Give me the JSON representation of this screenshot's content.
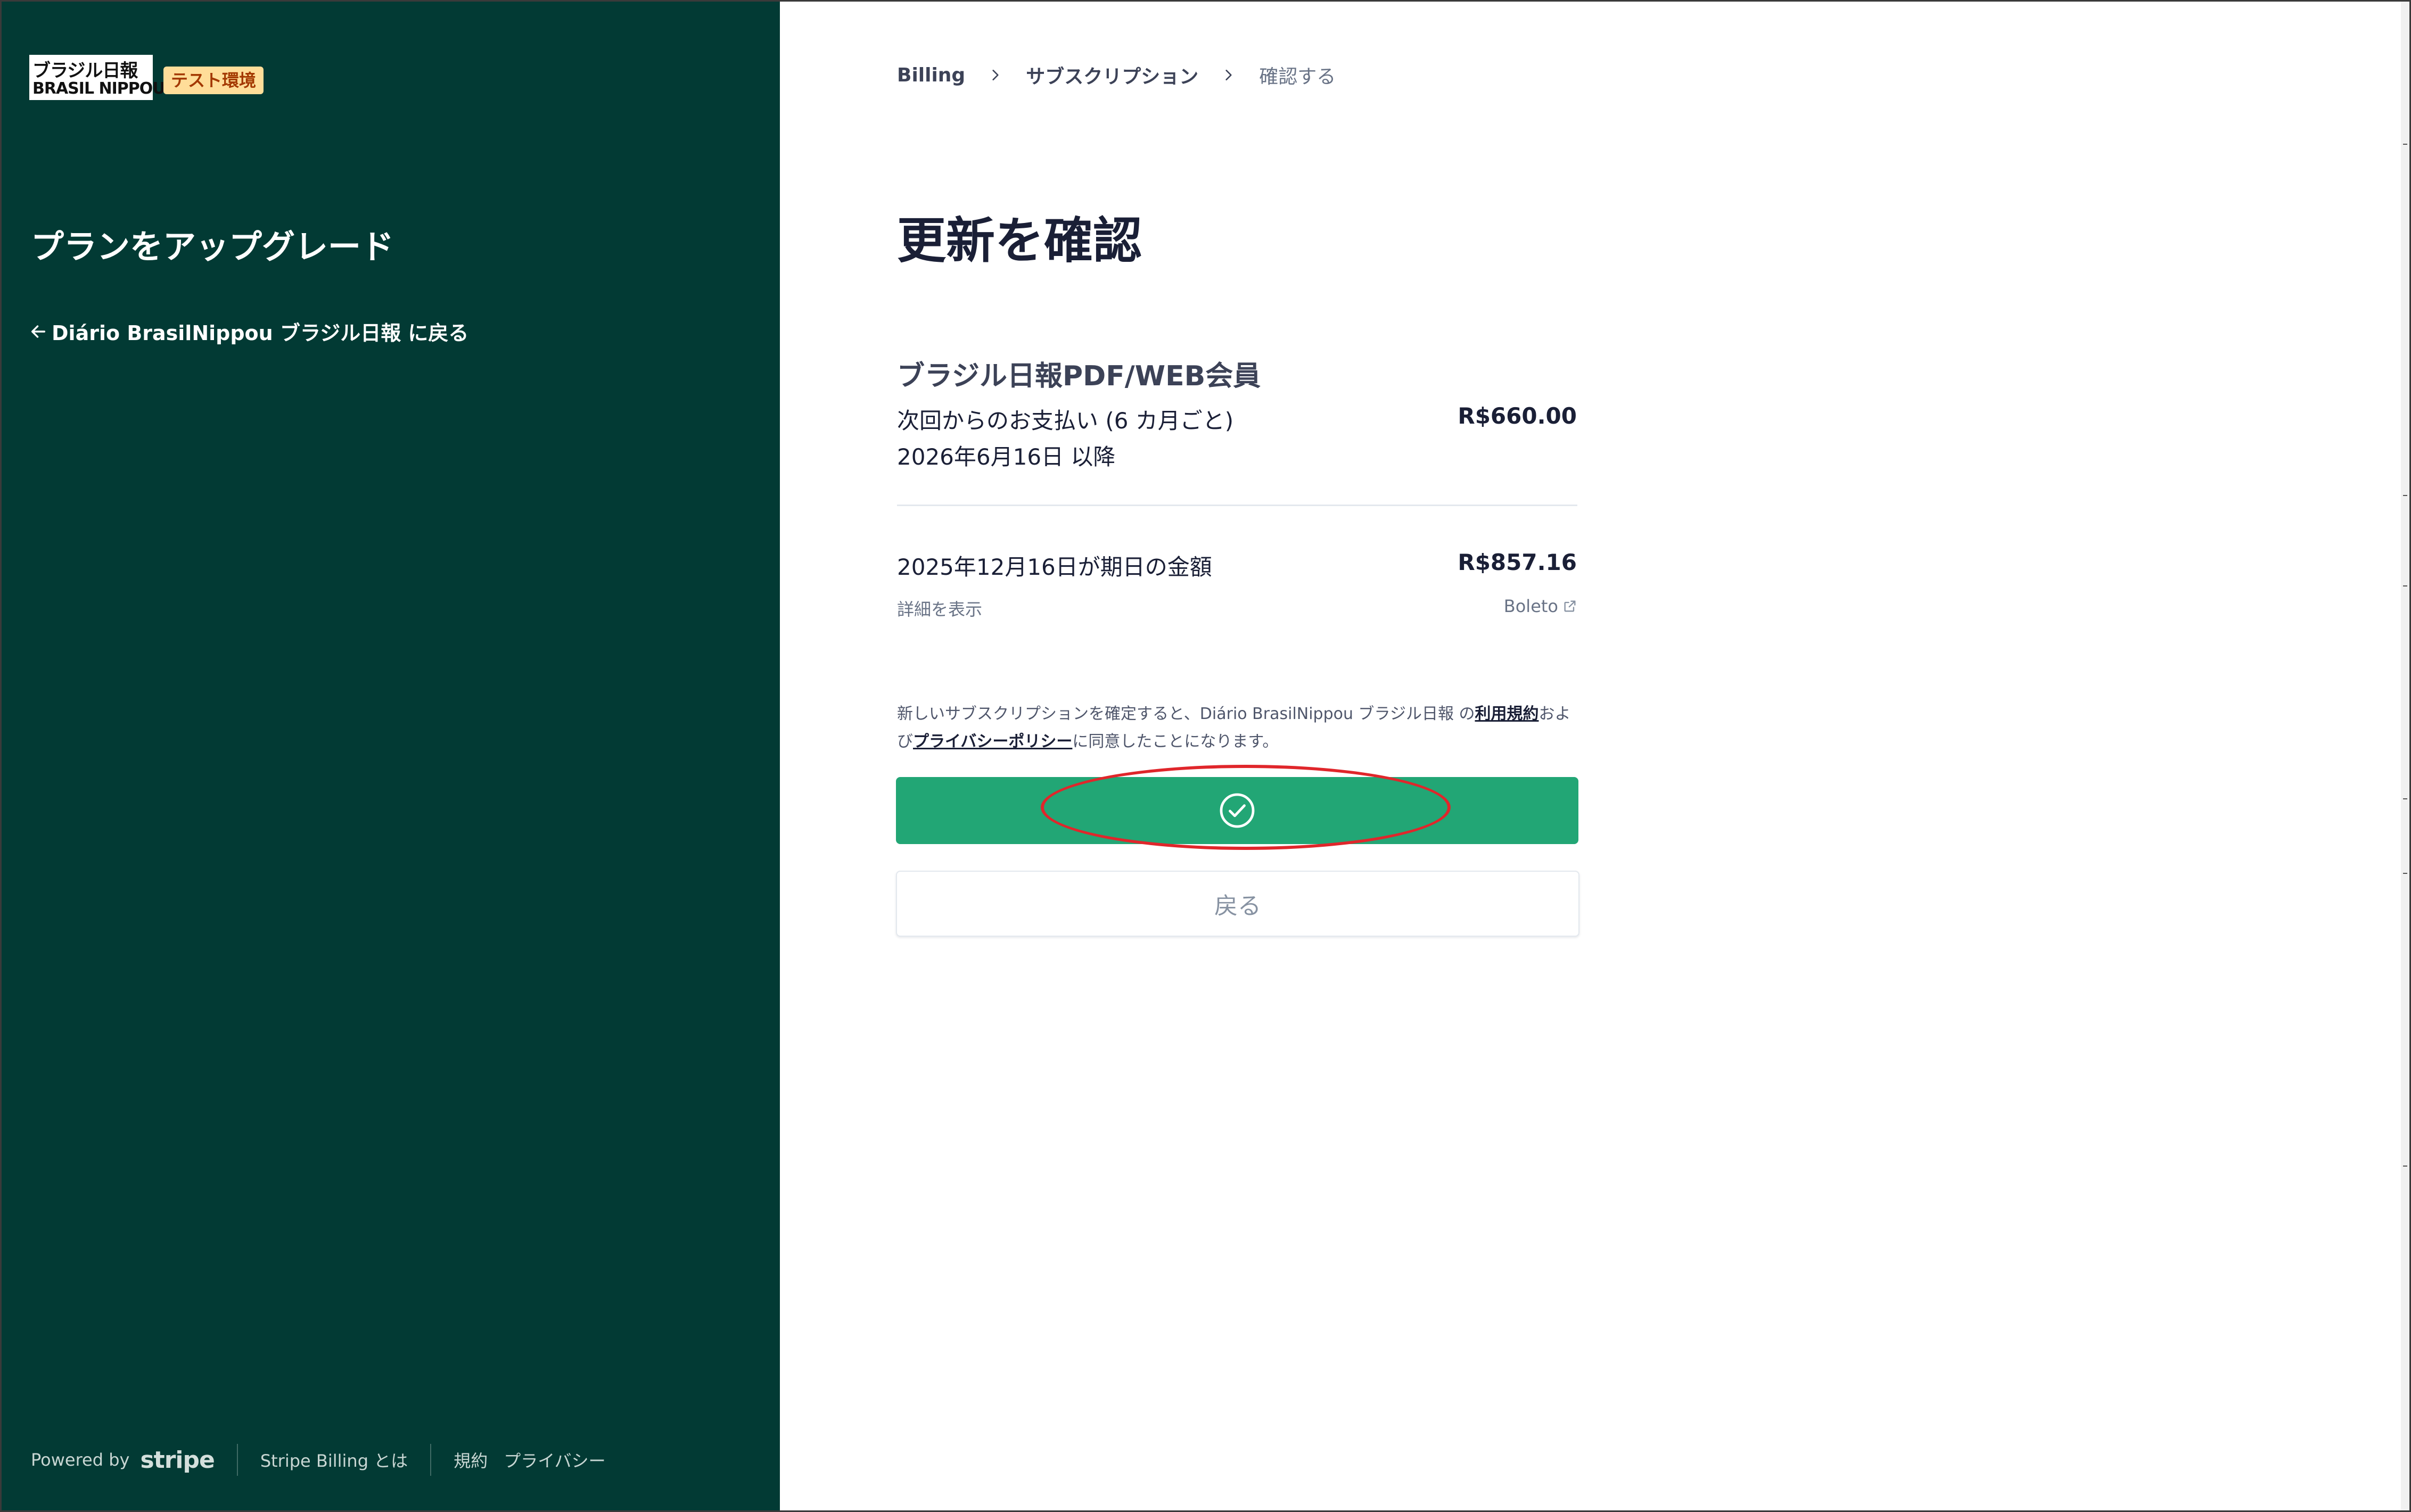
{
  "brand": {
    "logo_line1": "ブラジル日報",
    "logo_line2": "BRASIL NIPPOU",
    "test_badge": "テスト環境"
  },
  "left": {
    "title": "プランをアップグレード",
    "back_link": "Diário BrasilNippou ブラジル日報 に戻る"
  },
  "footer": {
    "powered_by": "Powered by",
    "stripe_wordmark": "stripe",
    "stripe_billing": "Stripe Billing とは",
    "terms": "規約",
    "privacy": "プライバシー"
  },
  "breadcrumb": {
    "items": [
      "Billing",
      "サブスクリプション",
      "確認する"
    ]
  },
  "page_title": "更新を確認",
  "plan": {
    "name": "ブラジル日報PDF/WEB会員",
    "next_payment_label": "次回からのお支払い (6 カ月ごと)",
    "next_payment_date": "2026年6月16日 以降",
    "next_payment_amount": "R$660.00",
    "due_label": "2025年12月16日が期日の金額",
    "due_amount": "R$857.16",
    "details_link": "詳細を表示",
    "payment_method": "Boleto"
  },
  "legal": {
    "prefix": "新しいサブスクリプションを確定すると、Diário BrasilNippou ブラジル日報 の",
    "terms_link": "利用規約",
    "and": "および",
    "privacy_link": "プライバシーポリシー",
    "suffix": "に同意したことになります。"
  },
  "buttons": {
    "back": "戻る"
  },
  "colors": {
    "sidebar_bg": "#023a34",
    "confirm_green": "#22a675",
    "highlight_red": "#e0262b",
    "badge_bg": "#ffdd99"
  },
  "icons": [
    "arrow-left-icon",
    "chevron-right-icon",
    "check-circle-icon",
    "external-link-icon"
  ]
}
